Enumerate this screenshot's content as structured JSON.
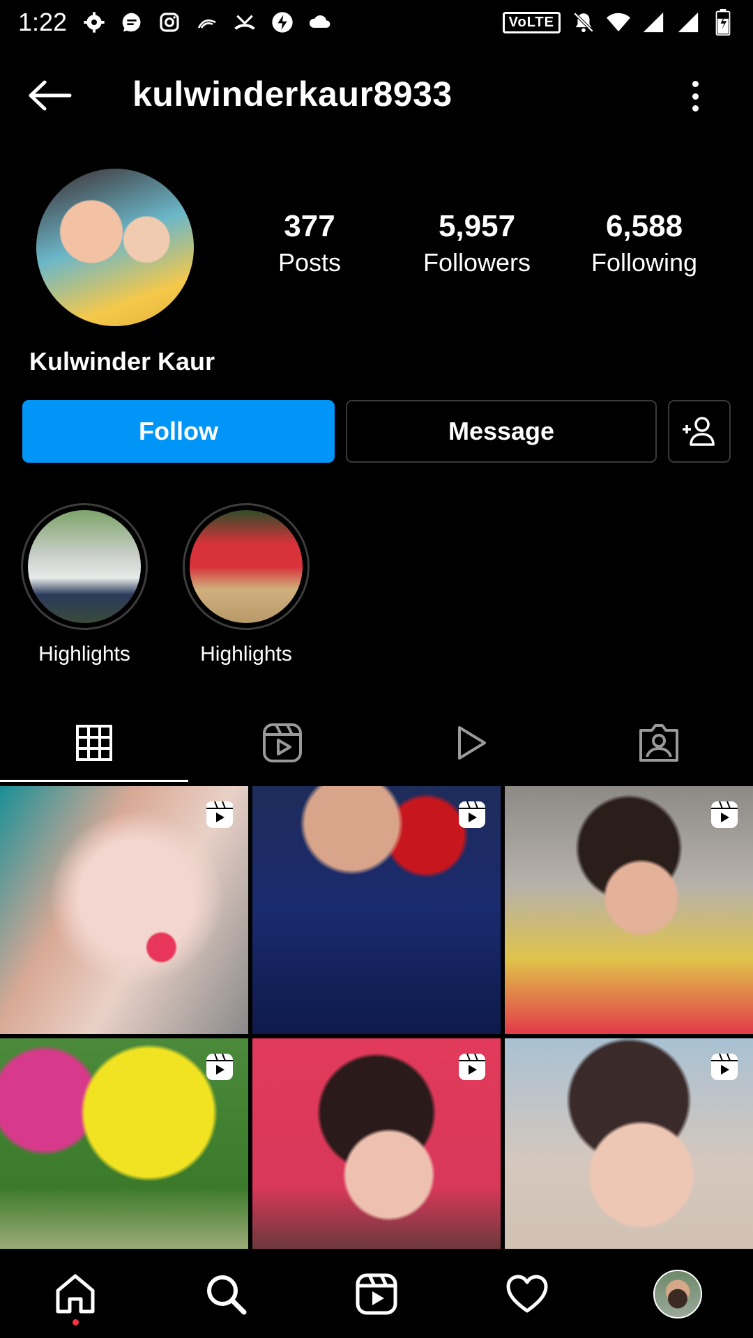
{
  "status_bar": {
    "time": "1:22",
    "volte_label": "VoLTE",
    "left_icons": [
      "settings-icon",
      "messages-icon",
      "instagram-icon",
      "hotspot-icon",
      "missed-call-icon",
      "bolt-icon",
      "cloud-icon"
    ],
    "right_icons": [
      "volte-badge",
      "muted-bell-icon",
      "wifi-icon",
      "signal-icon",
      "battery-icon"
    ]
  },
  "header": {
    "username": "kulwinderkaur8933"
  },
  "profile": {
    "display_name": "Kulwinder Kaur",
    "stats": [
      {
        "value": "377",
        "label": "Posts"
      },
      {
        "value": "5,957",
        "label": "Followers"
      },
      {
        "value": "6,588",
        "label": "Following"
      }
    ]
  },
  "actions": {
    "follow_label": "Follow",
    "message_label": "Message"
  },
  "highlights": [
    {
      "label": "Highlights"
    },
    {
      "label": "Highlights"
    }
  ],
  "tabs": [
    {
      "icon": "grid-icon",
      "active": true
    },
    {
      "icon": "reels-icon",
      "active": false
    },
    {
      "icon": "play-icon",
      "active": false
    },
    {
      "icon": "tagged-icon",
      "active": false
    }
  ],
  "grid_posts": [
    {
      "type": "reel"
    },
    {
      "type": "reel"
    },
    {
      "type": "reel"
    },
    {
      "type": "reel"
    },
    {
      "type": "reel"
    },
    {
      "type": "reel"
    }
  ],
  "bottom_nav": [
    {
      "icon": "home-icon",
      "has_notification": true
    },
    {
      "icon": "search-icon"
    },
    {
      "icon": "reels-icon"
    },
    {
      "icon": "heart-icon"
    },
    {
      "icon": "profile-avatar"
    }
  ],
  "colors": {
    "background": "#000000",
    "primary": "#0095f6",
    "notification_dot": "#ff3040",
    "border": "#3a3a3a"
  }
}
